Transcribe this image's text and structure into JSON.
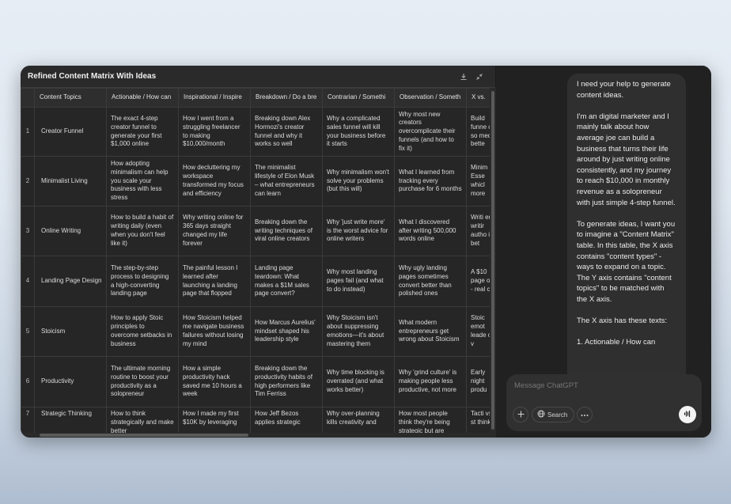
{
  "canvas": {
    "title": "Refined Content Matrix With Ideas",
    "columns": [
      "",
      "Content Topics",
      "Actionable / How can",
      "Inspirational / Inspire",
      "Breakdown / Do a bre",
      "Contrarian / Somethi",
      "Observation / Someth",
      "X vs."
    ],
    "rows": [
      {
        "idx": "1",
        "topic": "Creator Funnel",
        "cells": [
          "The exact 4-step creator funnel to generate your first $1,000 online",
          "How I went from a struggling freelancer to making $10,000/month",
          "Breaking down Alex Hormozi's creator funnel and why it works so well",
          "Why a complicated sales funnel will kill your business before it starts",
          "Why most new creators overcomplicate their funnels (and how to fix it)",
          "Build funne on so medi bette"
        ]
      },
      {
        "idx": "2",
        "topic": "Minimalist Living",
        "cells": [
          "How adopting minimalism can help you scale your business with less stress",
          "How decluttering my workspace transformed my focus and efficiency",
          "The minimalist lifestyle of Elon Musk – what entrepreneurs can learn",
          "Why minimalism won't solve your problems (but this will)",
          "What I learned from tracking every purchase for 6 months",
          "Minim Esse whicl more"
        ]
      },
      {
        "idx": "3",
        "topic": "Online Writing",
        "cells": [
          "How to build a habit of writing daily (even when you don't feel like it)",
          "Why writing online for 365 days straight changed my life forever",
          "Breaking down the writing techniques of viral online creators",
          "Why 'just write more' is the worst advice for online writers",
          "What I discovered after writing 500,000 words online",
          "Writi enga writir autho is bet"
        ]
      },
      {
        "idx": "4",
        "topic": "Landing Page Design",
        "cells": [
          "The step-by-step process to designing a high-converting landing page",
          "The painful lesson I learned after launching a landing page that flopped",
          "Landing page teardown: What makes a $1M sales page convert?",
          "Why most landing pages fail (and what to do instead)",
          "Why ugly landing pages sometimes convert better than polished ones",
          "A $10 page one - real c"
        ]
      },
      {
        "idx": "5",
        "topic": "Stoicism",
        "cells": [
          "How to apply Stoic principles to overcome setbacks in business",
          "How Stoicism helped me navigate business failures without losing my mind",
          "How Marcus Aurelius' mindset shaped his leadership style",
          "Why Stoicism isn't about suppressing emotions—it's about mastering them",
          "What modern entrepreneurs get wrong about Stoicism",
          "Stoic emot leade one v"
        ]
      },
      {
        "idx": "6",
        "topic": "Productivity",
        "cells": [
          "The ultimate morning routine to boost your productivity as a solopreneur",
          "How a simple productivity hack saved me 10 hours a week",
          "Breaking down the productivity habits of high performers like Tim Ferriss",
          "Why time blocking is overrated (and what works better)",
          "Why 'grind culture' is making people less productive, not more",
          "Early night produ"
        ]
      },
      {
        "idx": "7",
        "topic": "Strategic Thinking",
        "cells": [
          "How to think strategically and make better",
          "How I made my first $10K by leveraging",
          "How Jeff Bezos applies strategic",
          "Why over-planning kills creativity and",
          "How most people think they're being strategic but are",
          "Tacti vs. st think"
        ]
      }
    ]
  },
  "chat": {
    "message": [
      "I need your help to generate content ideas.",
      "I'm an digital marketer and I mainly talk about how average joe can build a business that turns their life around by just writing online consistently, and my journey to reach $10,000 in monthly revenue as a solopreneur with just simple 4-step funnel.",
      "To generate ideas, I want you to imagine a \"Content Matrix\" table. In this table, the X axis contains \"content types\" - ways to expand on a topic. The Y axis contains \"content topics\" to be matched with the X axis.",
      "The X axis has these texts:",
      "1. Actionable / How can"
    ],
    "composer": {
      "placeholder": "Message ChatGPT",
      "search_label": "Search"
    }
  },
  "icons": {
    "download": "download-icon",
    "collapse": "collapse-icon",
    "plus": "plus-icon",
    "globe": "globe-icon",
    "more": "more-icon",
    "voice": "voice-mode-icon"
  },
  "colors": {
    "panel": "#212121",
    "canvas": "#2a2a2a",
    "bubble": "#2f2f2f",
    "voice_button": "#f4f4f4"
  }
}
